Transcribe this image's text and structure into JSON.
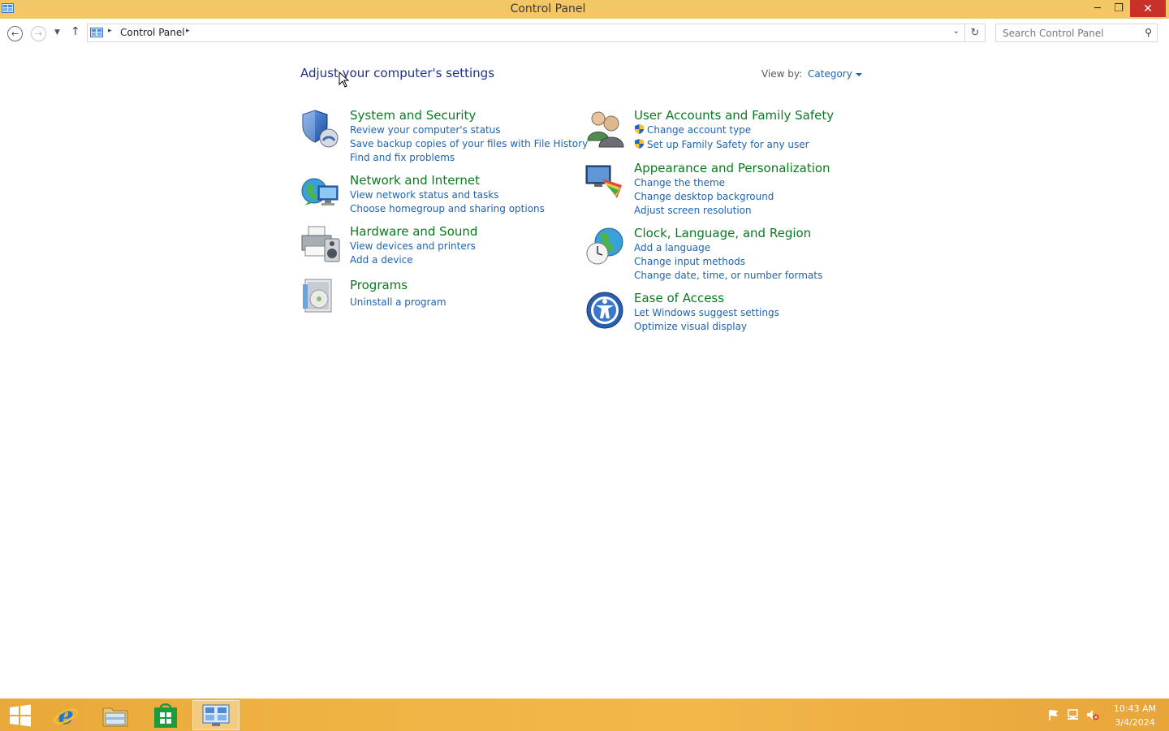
{
  "window": {
    "title": "Control Panel",
    "minimize_glyph": "─",
    "maximize_glyph": "❐",
    "close_glyph": "✕"
  },
  "nav": {
    "back_glyph": "←",
    "forward_glyph": "→",
    "recent_glyph": "▼",
    "up_glyph": "↑",
    "breadcrumb_sep": "▸",
    "breadcrumb": "Control Panel",
    "dropdown_glyph": "⌄",
    "refresh_glyph": "↻",
    "search_placeholder": "Search Control Panel",
    "search_glyph": "⚲"
  },
  "main": {
    "title": "Adjust your computer's settings",
    "view_by_label": "View by:",
    "view_by_value": "Category",
    "categories_left": [
      {
        "name": "System and Security",
        "icon": "shield-icon",
        "links": [
          "Review your computer's status",
          "Save backup copies of your files with File History",
          "Find and fix problems"
        ]
      },
      {
        "name": "Network and Internet",
        "icon": "network-globe-icon",
        "links": [
          "View network status and tasks",
          "Choose homegroup and sharing options"
        ]
      },
      {
        "name": "Hardware and Sound",
        "icon": "printer-speaker-icon",
        "links": [
          "View devices and printers",
          "Add a device"
        ]
      },
      {
        "name": "Programs",
        "icon": "programs-disc-icon",
        "links": [
          "Uninstall a program"
        ]
      }
    ],
    "categories_right": [
      {
        "name": "User Accounts and Family Safety",
        "icon": "users-icon",
        "links": [
          "Change account type",
          "Set up Family Safety for any user"
        ]
      },
      {
        "name": "Appearance and Personalization",
        "icon": "monitor-palette-icon",
        "links": [
          "Change the theme",
          "Change desktop background",
          "Adjust screen resolution"
        ]
      },
      {
        "name": "Clock, Language, and Region",
        "icon": "globe-clock-icon",
        "links": [
          "Add a language",
          "Change input methods",
          "Change date, time, or number formats"
        ]
      },
      {
        "name": "Ease of Access",
        "icon": "ease-of-access-icon",
        "links": [
          "Let Windows suggest settings",
          "Optimize visual display"
        ]
      }
    ]
  },
  "taskbar": {
    "time": "10:43 AM",
    "date": "3/4/2024"
  },
  "colors": {
    "titlebar": "#f3c766",
    "heading_green": "#0b7a1f",
    "link_blue": "#1e63b0",
    "title_blue": "#1e3287",
    "close_red": "#c7312a"
  }
}
